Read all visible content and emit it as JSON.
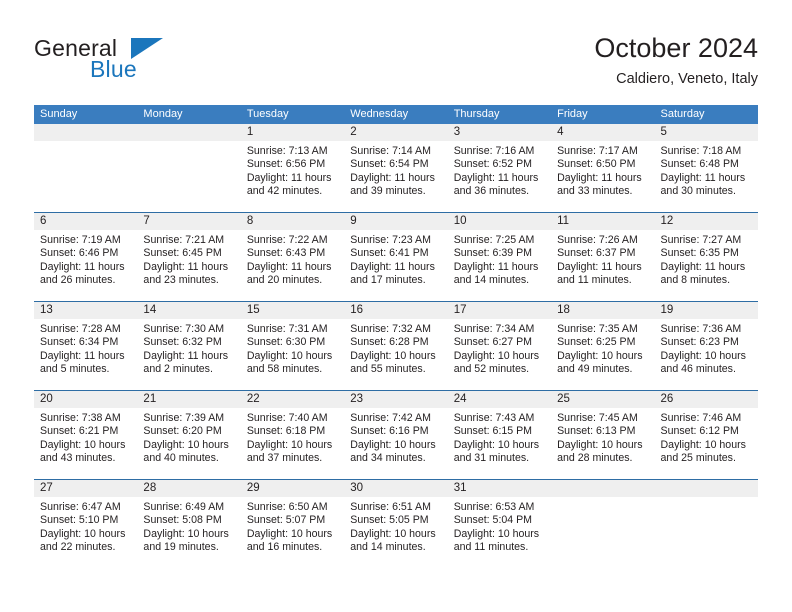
{
  "brand": {
    "name_top": "General",
    "name_bottom": "Blue",
    "accent_color": "#1b76bc",
    "triangle_icon": "brand-triangle-icon"
  },
  "header": {
    "title": "October 2024",
    "subtitle": "Caldiero, Veneto, Italy"
  },
  "colors": {
    "header_blue": "#3a7dbf",
    "week_divider": "#2e6da4",
    "daynum_band": "#efefef",
    "text": "#231f20"
  },
  "weekdays": [
    "Sunday",
    "Monday",
    "Tuesday",
    "Wednesday",
    "Thursday",
    "Friday",
    "Saturday"
  ],
  "weeks": [
    [
      {
        "day": "",
        "lines": []
      },
      {
        "day": "",
        "lines": []
      },
      {
        "day": "1",
        "lines": [
          "Sunrise: 7:13 AM",
          "Sunset: 6:56 PM",
          "Daylight: 11 hours",
          "and 42 minutes."
        ]
      },
      {
        "day": "2",
        "lines": [
          "Sunrise: 7:14 AM",
          "Sunset: 6:54 PM",
          "Daylight: 11 hours",
          "and 39 minutes."
        ]
      },
      {
        "day": "3",
        "lines": [
          "Sunrise: 7:16 AM",
          "Sunset: 6:52 PM",
          "Daylight: 11 hours",
          "and 36 minutes."
        ]
      },
      {
        "day": "4",
        "lines": [
          "Sunrise: 7:17 AM",
          "Sunset: 6:50 PM",
          "Daylight: 11 hours",
          "and 33 minutes."
        ]
      },
      {
        "day": "5",
        "lines": [
          "Sunrise: 7:18 AM",
          "Sunset: 6:48 PM",
          "Daylight: 11 hours",
          "and 30 minutes."
        ]
      }
    ],
    [
      {
        "day": "6",
        "lines": [
          "Sunrise: 7:19 AM",
          "Sunset: 6:46 PM",
          "Daylight: 11 hours",
          "and 26 minutes."
        ]
      },
      {
        "day": "7",
        "lines": [
          "Sunrise: 7:21 AM",
          "Sunset: 6:45 PM",
          "Daylight: 11 hours",
          "and 23 minutes."
        ]
      },
      {
        "day": "8",
        "lines": [
          "Sunrise: 7:22 AM",
          "Sunset: 6:43 PM",
          "Daylight: 11 hours",
          "and 20 minutes."
        ]
      },
      {
        "day": "9",
        "lines": [
          "Sunrise: 7:23 AM",
          "Sunset: 6:41 PM",
          "Daylight: 11 hours",
          "and 17 minutes."
        ]
      },
      {
        "day": "10",
        "lines": [
          "Sunrise: 7:25 AM",
          "Sunset: 6:39 PM",
          "Daylight: 11 hours",
          "and 14 minutes."
        ]
      },
      {
        "day": "11",
        "lines": [
          "Sunrise: 7:26 AM",
          "Sunset: 6:37 PM",
          "Daylight: 11 hours",
          "and 11 minutes."
        ]
      },
      {
        "day": "12",
        "lines": [
          "Sunrise: 7:27 AM",
          "Sunset: 6:35 PM",
          "Daylight: 11 hours",
          "and 8 minutes."
        ]
      }
    ],
    [
      {
        "day": "13",
        "lines": [
          "Sunrise: 7:28 AM",
          "Sunset: 6:34 PM",
          "Daylight: 11 hours",
          "and 5 minutes."
        ]
      },
      {
        "day": "14",
        "lines": [
          "Sunrise: 7:30 AM",
          "Sunset: 6:32 PM",
          "Daylight: 11 hours",
          "and 2 minutes."
        ]
      },
      {
        "day": "15",
        "lines": [
          "Sunrise: 7:31 AM",
          "Sunset: 6:30 PM",
          "Daylight: 10 hours",
          "and 58 minutes."
        ]
      },
      {
        "day": "16",
        "lines": [
          "Sunrise: 7:32 AM",
          "Sunset: 6:28 PM",
          "Daylight: 10 hours",
          "and 55 minutes."
        ]
      },
      {
        "day": "17",
        "lines": [
          "Sunrise: 7:34 AM",
          "Sunset: 6:27 PM",
          "Daylight: 10 hours",
          "and 52 minutes."
        ]
      },
      {
        "day": "18",
        "lines": [
          "Sunrise: 7:35 AM",
          "Sunset: 6:25 PM",
          "Daylight: 10 hours",
          "and 49 minutes."
        ]
      },
      {
        "day": "19",
        "lines": [
          "Sunrise: 7:36 AM",
          "Sunset: 6:23 PM",
          "Daylight: 10 hours",
          "and 46 minutes."
        ]
      }
    ],
    [
      {
        "day": "20",
        "lines": [
          "Sunrise: 7:38 AM",
          "Sunset: 6:21 PM",
          "Daylight: 10 hours",
          "and 43 minutes."
        ]
      },
      {
        "day": "21",
        "lines": [
          "Sunrise: 7:39 AM",
          "Sunset: 6:20 PM",
          "Daylight: 10 hours",
          "and 40 minutes."
        ]
      },
      {
        "day": "22",
        "lines": [
          "Sunrise: 7:40 AM",
          "Sunset: 6:18 PM",
          "Daylight: 10 hours",
          "and 37 minutes."
        ]
      },
      {
        "day": "23",
        "lines": [
          "Sunrise: 7:42 AM",
          "Sunset: 6:16 PM",
          "Daylight: 10 hours",
          "and 34 minutes."
        ]
      },
      {
        "day": "24",
        "lines": [
          "Sunrise: 7:43 AM",
          "Sunset: 6:15 PM",
          "Daylight: 10 hours",
          "and 31 minutes."
        ]
      },
      {
        "day": "25",
        "lines": [
          "Sunrise: 7:45 AM",
          "Sunset: 6:13 PM",
          "Daylight: 10 hours",
          "and 28 minutes."
        ]
      },
      {
        "day": "26",
        "lines": [
          "Sunrise: 7:46 AM",
          "Sunset: 6:12 PM",
          "Daylight: 10 hours",
          "and 25 minutes."
        ]
      }
    ],
    [
      {
        "day": "27",
        "lines": [
          "Sunrise: 6:47 AM",
          "Sunset: 5:10 PM",
          "Daylight: 10 hours",
          "and 22 minutes."
        ]
      },
      {
        "day": "28",
        "lines": [
          "Sunrise: 6:49 AM",
          "Sunset: 5:08 PM",
          "Daylight: 10 hours",
          "and 19 minutes."
        ]
      },
      {
        "day": "29",
        "lines": [
          "Sunrise: 6:50 AM",
          "Sunset: 5:07 PM",
          "Daylight: 10 hours",
          "and 16 minutes."
        ]
      },
      {
        "day": "30",
        "lines": [
          "Sunrise: 6:51 AM",
          "Sunset: 5:05 PM",
          "Daylight: 10 hours",
          "and 14 minutes."
        ]
      },
      {
        "day": "31",
        "lines": [
          "Sunrise: 6:53 AM",
          "Sunset: 5:04 PM",
          "Daylight: 10 hours",
          "and 11 minutes."
        ]
      },
      {
        "day": "",
        "lines": []
      },
      {
        "day": "",
        "lines": []
      }
    ]
  ]
}
